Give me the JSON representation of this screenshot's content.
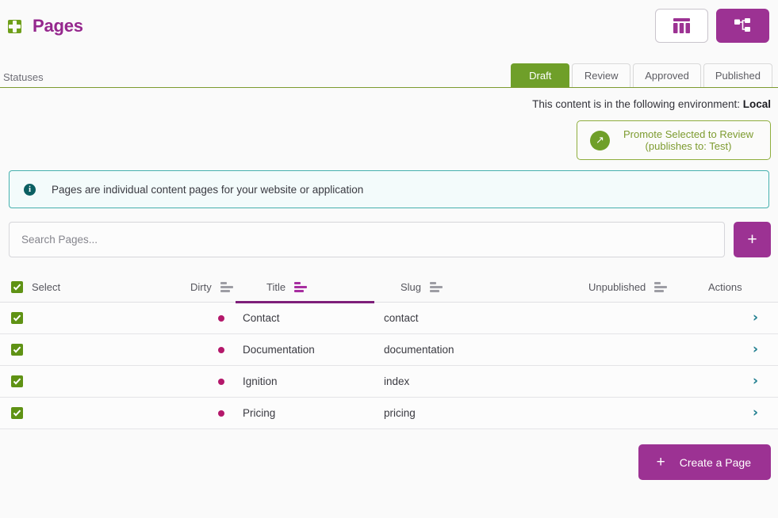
{
  "header": {
    "title": "Pages",
    "brand_icon": "puzzle-piece-icon",
    "view_toggles": [
      {
        "name": "table-view-toggle",
        "icon": "table-columns-icon",
        "active": false
      },
      {
        "name": "tree-view-toggle",
        "icon": "sitemap-icon",
        "active": true
      }
    ]
  },
  "statuses": {
    "label": "Statuses",
    "tabs": [
      {
        "label": "Draft",
        "active": true
      },
      {
        "label": "Review",
        "active": false
      },
      {
        "label": "Approved",
        "active": false
      },
      {
        "label": "Published",
        "active": false
      }
    ]
  },
  "environment": {
    "prefix": "This content is in the following environment:",
    "name": "Local",
    "promote": {
      "line1": "Promote Selected to Review",
      "line2": "(publishes to: Test)",
      "icon": "arrow-up-right-icon"
    }
  },
  "info_banner": {
    "icon": "info-icon",
    "text": "Pages are individual content pages for your website or application"
  },
  "search": {
    "placeholder": "Search Pages...",
    "value": "",
    "add_label": "+"
  },
  "table": {
    "columns": [
      {
        "key": "select",
        "label": "Select",
        "sortable": false,
        "sorted": false
      },
      {
        "key": "dirty",
        "label": "Dirty",
        "sortable": true,
        "sorted": false
      },
      {
        "key": "title",
        "label": "Title",
        "sortable": true,
        "sorted": true
      },
      {
        "key": "slug",
        "label": "Slug",
        "sortable": true,
        "sorted": false
      },
      {
        "key": "unpublished",
        "label": "Unpublished",
        "sortable": true,
        "sorted": false
      },
      {
        "key": "actions",
        "label": "Actions",
        "sortable": false,
        "sorted": false
      }
    ],
    "rows": [
      {
        "selected": true,
        "dirty": true,
        "title": "Contact",
        "slug": "contact",
        "unpublished": ""
      },
      {
        "selected": true,
        "dirty": true,
        "title": "Documentation",
        "slug": "documentation",
        "unpublished": ""
      },
      {
        "selected": true,
        "dirty": true,
        "title": "Ignition",
        "slug": "index",
        "unpublished": ""
      },
      {
        "selected": true,
        "dirty": true,
        "title": "Pricing",
        "slug": "pricing",
        "unpublished": ""
      }
    ]
  },
  "footer": {
    "create_label": "Create a Page",
    "create_plus": "+"
  },
  "colors": {
    "brand_purple": "#95278d",
    "button_purple": "#9c3293",
    "green": "#6f9f29",
    "teal": "#46b0ae",
    "dirty_dot": "#b4186b",
    "chevron": "#1f7e8f"
  }
}
